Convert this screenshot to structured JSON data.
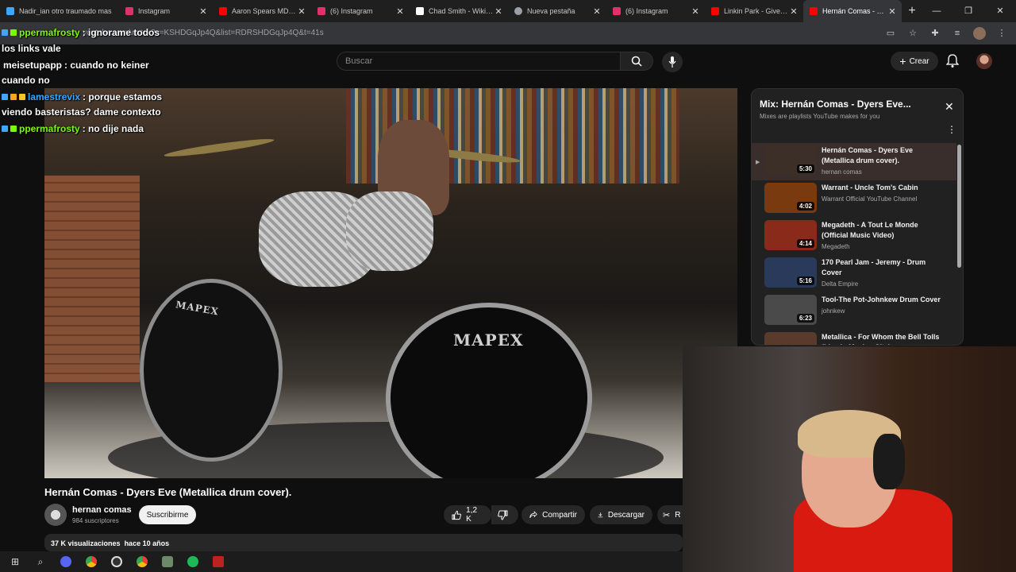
{
  "browser": {
    "tabs": [
      {
        "label": "Nadir_ian otro traumado mas",
        "color": "#3ea6ff"
      },
      {
        "label": "Instagram",
        "color": "#e1306c"
      },
      {
        "label": "Aaron Spears MD Fe",
        "color": "#ff0000"
      },
      {
        "label": "(6) Instagram",
        "color": "#e1306c"
      },
      {
        "label": "Chad Smith - Wikipe",
        "color": "#ffffff"
      },
      {
        "label": "Nueva pestaña",
        "color": "#9aa0a6"
      },
      {
        "label": "(6) Instagram",
        "color": "#e1306c"
      },
      {
        "label": "Linkin Park - Given U",
        "color": "#ff0000"
      },
      {
        "label": "Hernán Comas - Dye",
        "color": "#ff0000"
      }
    ],
    "url": "youtube.com/watch?v=KSHDGqJp4Q&list=RDRSHDGqJp4Q&t=41s"
  },
  "header": {
    "search_placeholder": "Buscar",
    "create_label": "Crear"
  },
  "chat": [
    {
      "user": "ppermafrosty",
      "msg": ": ignorame todos"
    },
    {
      "user": "",
      "msg": "los links vale"
    },
    {
      "user": "meisetupapp",
      "msg": ": cuando no keiner"
    },
    {
      "user": "",
      "msg": "cuando no"
    },
    {
      "user": "lamestrevix",
      "msg": ": porque estamos"
    },
    {
      "user": "",
      "msg": "viendo basteristas? dame contexto"
    },
    {
      "user": "ppermafrosty",
      "msg": ": no dije nada"
    }
  ],
  "video": {
    "title": "Hernán Comas - Dyers Eve (Metallica drum cover).",
    "channel": "hernan comas",
    "subscribers": "984 suscriptores",
    "subscribe_label": "Suscribirme",
    "likes": "1,2 K",
    "share_label": "Compartir",
    "download_label": "Descargar",
    "clip_label": "R",
    "views": "37 K visualizaciones",
    "age": "hace 10 años"
  },
  "mix": {
    "title": "Mix: Hernán Comas - Dyers Eve...",
    "subtitle": "Mixes are playlists YouTube makes for you",
    "items": [
      {
        "title": "Hernán Comas - Dyers Eve (Metallica drum cover).",
        "channel": "hernan comas",
        "duration": "5:30",
        "thumb": "#3b2f28"
      },
      {
        "title": "Warrant - Uncle Tom's Cabin",
        "channel": "Warrant Official YouTube Channel",
        "duration": "4:02",
        "thumb": "#7a3a10"
      },
      {
        "title": "Megadeth - A Tout Le Monde (Official Music Video)",
        "channel": "Megadeth",
        "duration": "4:14",
        "thumb": "#8a2a1a"
      },
      {
        "title": "170 Pearl Jam - Jeremy - Drum Cover",
        "channel": "Delta Empire",
        "duration": "5:16",
        "thumb": "#2a3a5a"
      },
      {
        "title": "Tool-The Pot-Johnkew Drum Cover",
        "channel": "johnkew",
        "duration": "6:23",
        "thumb": "#4a4a4a"
      },
      {
        "title": "Metallica - For Whom the Bell Tolls (Live in Mexico City)",
        "channel": "",
        "duration": "",
        "thumb": "#5a3a2a"
      }
    ]
  },
  "logo_text": "MAPEX"
}
